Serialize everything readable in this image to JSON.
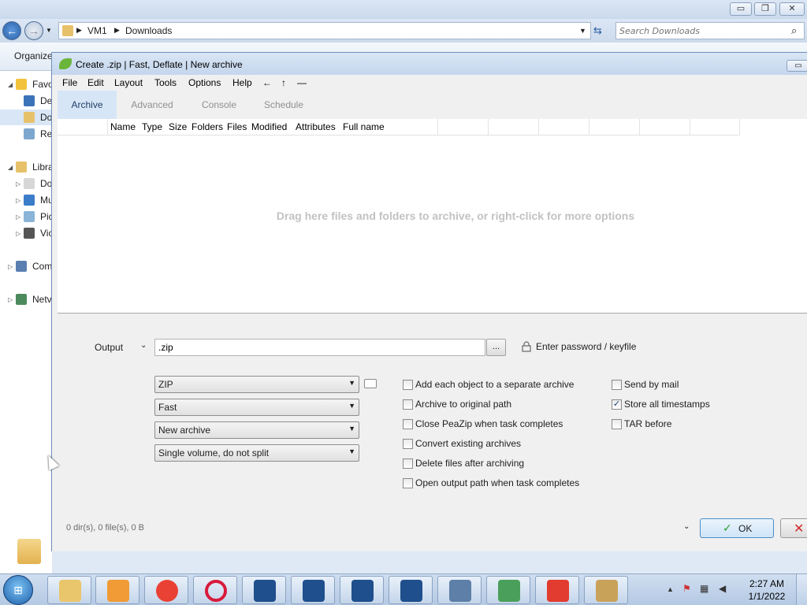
{
  "explorer": {
    "address": {
      "part1": "VM1",
      "part2": "Downloads"
    },
    "search_placeholder": "Search Downloads",
    "toolbar": {
      "organize": "Organize"
    },
    "nav": [
      {
        "label": "Favo",
        "color": "#f3c23b"
      },
      {
        "label": "De",
        "color": "#3a73b8"
      },
      {
        "label": "Do",
        "color": "#e7c16a"
      },
      {
        "label": "Re",
        "color": "#7ea7cf"
      },
      {
        "label": "Libra",
        "color": "#e7c16a"
      },
      {
        "label": "Do",
        "color": "#d7d7d7"
      },
      {
        "label": "Mu",
        "color": "#3b7dc8"
      },
      {
        "label": "Pic",
        "color": "#8ab4d8"
      },
      {
        "label": "Vic",
        "color": "#555555"
      },
      {
        "label": "Com",
        "color": "#5a7fb0"
      },
      {
        "label": "Netv",
        "color": "#4b8a5c"
      }
    ],
    "window_buttons": {
      "minimize": "▭",
      "restore": "❐",
      "close": "✕"
    }
  },
  "peazip": {
    "title": "Create .zip | Fast, Deflate | New archive",
    "menu": [
      "File",
      "Edit",
      "Layout",
      "Tools",
      "Options",
      "Help",
      "←",
      "↑",
      "—"
    ],
    "tabs": [
      {
        "label": "Archive",
        "active": true
      },
      {
        "label": "Advanced",
        "active": false
      },
      {
        "label": "Console",
        "active": false
      },
      {
        "label": "Schedule",
        "active": false
      }
    ],
    "columns": [
      "Name",
      "Type",
      "Size",
      "Folders",
      "Files",
      "Modified",
      "Attributes",
      "Full name"
    ],
    "drop_hint": "Drag here files and folders to archive, or right-click for more options",
    "output": {
      "label": "Output",
      "value": ".zip",
      "browse_label": "...",
      "password_label": "Enter password / keyfile"
    },
    "combos": {
      "format": "ZIP",
      "level": "Fast",
      "mode": "New archive",
      "volume": "Single volume, do not split"
    },
    "options_col1": [
      {
        "label": "Add each object to a separate archive",
        "checked": false
      },
      {
        "label": "Archive to original path",
        "checked": false
      },
      {
        "label": "Close PeaZip when task completes",
        "checked": false
      },
      {
        "label": "Convert existing archives",
        "checked": false
      },
      {
        "label": "Delete files after archiving",
        "checked": false
      },
      {
        "label": "Open output path when task completes",
        "checked": false
      }
    ],
    "options_col2": [
      {
        "label": "Send by mail",
        "checked": false
      },
      {
        "label": "Store all timestamps",
        "checked": true
      },
      {
        "label": "TAR before",
        "checked": false
      }
    ],
    "status": "0 dir(s), 0 file(s), 0 B",
    "ok_label": "OK",
    "check_mark": "✓",
    "cancel_x": "✕",
    "minimize": "▭"
  },
  "taskbar": {
    "items": [
      {
        "name": "explorer-task",
        "color": "#e9c56b"
      },
      {
        "name": "media-player-task",
        "color": "#f09b36"
      },
      {
        "name": "chrome-task",
        "color": "#e94235"
      },
      {
        "name": "opera-task",
        "color": "#d81b3c"
      },
      {
        "name": "app1-task",
        "color": "#1f4f8c"
      },
      {
        "name": "app2-task",
        "color": "#1f4f8c"
      },
      {
        "name": "app3-task",
        "color": "#1f4f8c"
      },
      {
        "name": "app4-task",
        "color": "#1f4f8c"
      },
      {
        "name": "network-task",
        "color": "#5d7fa8"
      },
      {
        "name": "mail-task",
        "color": "#4aa05a"
      },
      {
        "name": "anydesk-task",
        "color": "#e23b30"
      },
      {
        "name": "peazip-task",
        "color": "#c9a25a"
      }
    ],
    "tray": {
      "arrow": "▲",
      "flag": "⚑",
      "network": "▦",
      "volume": "◀"
    },
    "clock": {
      "time": "2:27 AM",
      "date": "1/1/2022"
    }
  }
}
